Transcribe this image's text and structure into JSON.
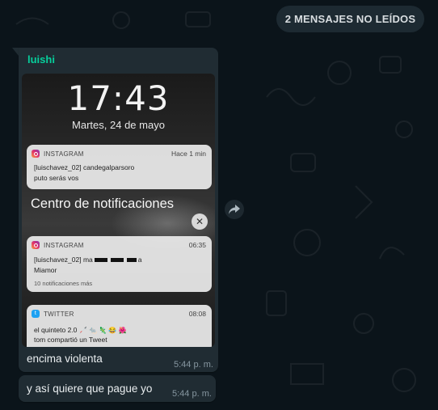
{
  "banner": {
    "unread_label": "2 MENSAJES NO LEÍDOS"
  },
  "message_image": {
    "sender": "luishi",
    "caption": "encima violenta",
    "time": "5:44 p. m.",
    "screenshot": {
      "lock_time": "17:43",
      "lock_date": "Martes, 24 de mayo",
      "notif1": {
        "app": "INSTAGRAM",
        "when": "Hace 1 min",
        "title": "[luischavez_02] candegalparsoro",
        "body": "puto serás vos"
      },
      "center_title": "Centro de notificaciones",
      "close_glyph": "✕",
      "notif2": {
        "app": "INSTAGRAM",
        "when": "06:35",
        "title_start": "[luischavez_02] ma",
        "title_end": "a",
        "body": "Miamor",
        "more": "10 notificaciones más"
      },
      "notif3": {
        "app": "TWITTER",
        "when": "08:08",
        "title": "el quinteto 2.0",
        "emoji": "🦯 🐀 🦎 😂 🌺",
        "body": "tom compartió un Tweet"
      }
    }
  },
  "message_text": {
    "text": "y así quiere que pague yo",
    "time": "5:44 p. m."
  },
  "colors": {
    "background": "#0b141a",
    "bubble": "#202c33",
    "sender": "#06cf9c",
    "meta": "#8696a0"
  },
  "icons": {
    "forward": "forward-arrow-icon",
    "instagram": "instagram-icon",
    "twitter": "twitter-icon"
  }
}
